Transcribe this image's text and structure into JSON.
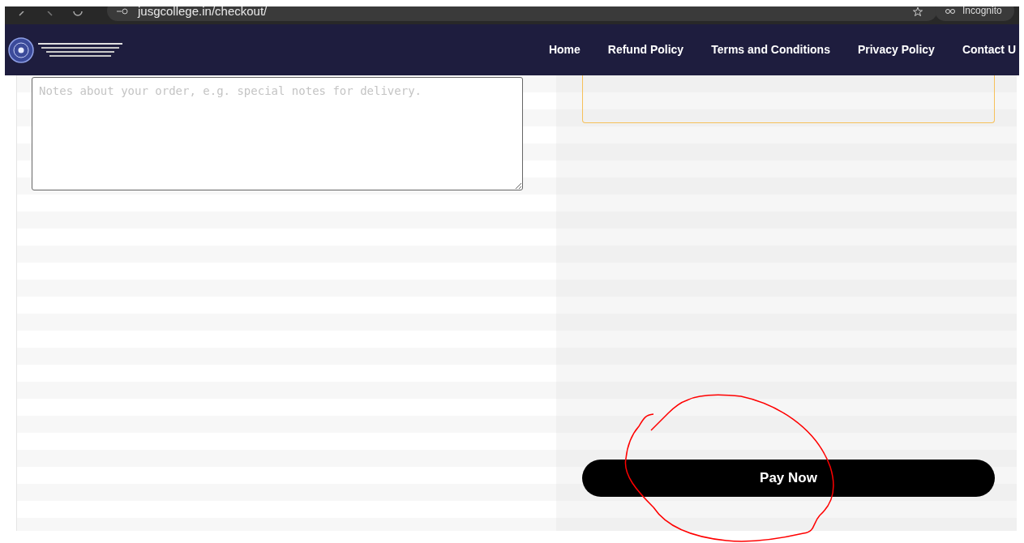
{
  "browser": {
    "url": "jusgcollege.in/checkout/",
    "profile": "Incognito"
  },
  "nav": {
    "links": [
      {
        "label": "Home"
      },
      {
        "label": "Refund Policy"
      },
      {
        "label": "Terms and Conditions"
      },
      {
        "label": "Privacy Policy"
      },
      {
        "label": "Contact U"
      }
    ]
  },
  "order_notes": {
    "placeholder": "Notes about your order, e.g. special notes for delivery."
  },
  "payment": {
    "button": "Pay Now"
  }
}
